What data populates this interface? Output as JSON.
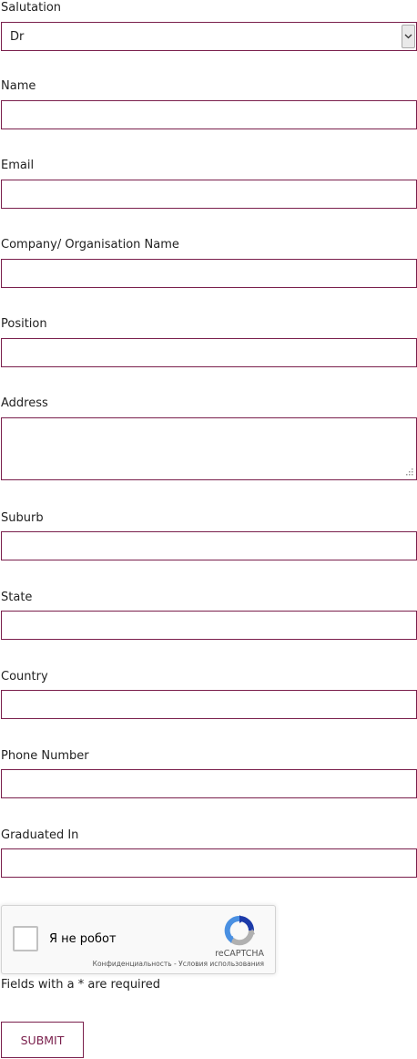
{
  "form": {
    "salutation": {
      "label": "Salutation",
      "selected": "Dr"
    },
    "name": {
      "label": "Name",
      "value": ""
    },
    "email": {
      "label": "Email",
      "value": ""
    },
    "company": {
      "label": "Company/ Organisation Name",
      "value": ""
    },
    "position": {
      "label": "Position",
      "value": ""
    },
    "address": {
      "label": "Address",
      "value": ""
    },
    "suburb": {
      "label": "Suburb",
      "value": ""
    },
    "state": {
      "label": "State",
      "value": ""
    },
    "country": {
      "label": "Country",
      "value": ""
    },
    "phone": {
      "label": "Phone Number",
      "value": ""
    },
    "graduated": {
      "label": "Graduated In",
      "value": ""
    }
  },
  "captcha": {
    "label": "Я не робот",
    "brand": "reCAPTCHA",
    "privacy": "Конфиденциальность",
    "separator": " - ",
    "terms": "Условия использования"
  },
  "required_note": "Fields with a * are required",
  "submit_label": "SUBMIT",
  "colors": {
    "accent": "#7a1f4c",
    "captcha_blue": "#1c3aa9",
    "captcha_lightblue": "#4a90e2",
    "captcha_gray": "#b0b0b0"
  }
}
